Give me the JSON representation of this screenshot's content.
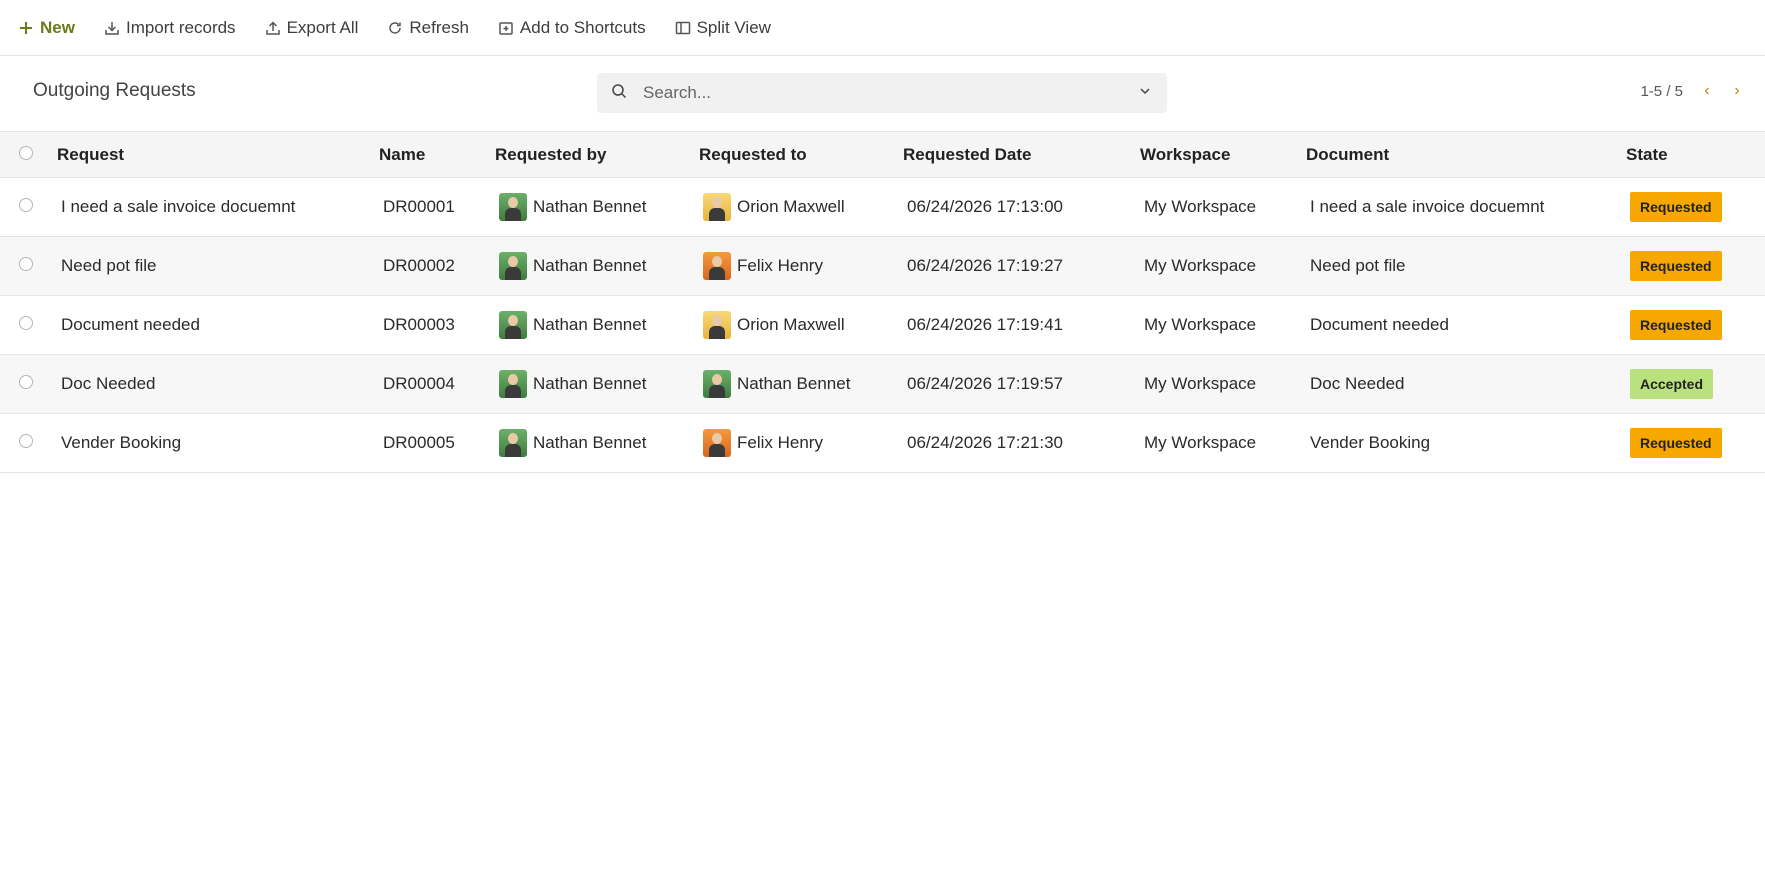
{
  "toolbar": {
    "new_label": "New",
    "import_label": "Import records",
    "export_label": "Export All",
    "refresh_label": "Refresh",
    "shortcuts_label": "Add to Shortcuts",
    "split_label": "Split View"
  },
  "header": {
    "title": "Outgoing Requests",
    "search_placeholder": "Search...",
    "pager_text": "1-5 / 5"
  },
  "table": {
    "columns": [
      "Request",
      "Name",
      "Requested by",
      "Requested to",
      "Requested Date",
      "Workspace",
      "Document",
      "State"
    ],
    "rows": [
      {
        "request": "I need a sale invoice docuemnt",
        "name": "DR00001",
        "by": "Nathan Bennet",
        "by_avatar": "green",
        "to": "Orion Maxwell",
        "to_avatar": "yellow",
        "date": "06/24/2026 17:13:00",
        "workspace": "My Workspace",
        "document": "I need a sale invoice docuemnt",
        "state": "Requested",
        "state_color": "#f7a800"
      },
      {
        "request": "Need pot file",
        "name": "DR00002",
        "by": "Nathan Bennet",
        "by_avatar": "green",
        "to": "Felix Henry",
        "to_avatar": "orange",
        "date": "06/24/2026 17:19:27",
        "workspace": "My Workspace",
        "document": "Need pot file",
        "state": "Requested",
        "state_color": "#f7a800"
      },
      {
        "request": "Document needed",
        "name": "DR00003",
        "by": "Nathan Bennet",
        "by_avatar": "green",
        "to": "Orion Maxwell",
        "to_avatar": "yellow",
        "date": "06/24/2026 17:19:41",
        "workspace": "My Workspace",
        "document": "Document needed",
        "state": "Requested",
        "state_color": "#f7a800"
      },
      {
        "request": "Doc Needed",
        "name": "DR00004",
        "by": "Nathan Bennet",
        "by_avatar": "green",
        "to": "Nathan Bennet",
        "to_avatar": "green",
        "date": "06/24/2026 17:19:57",
        "workspace": "My Workspace",
        "document": "Doc Needed",
        "state": "Accepted",
        "state_color": "#b9e27f"
      },
      {
        "request": "Vender Booking",
        "name": "DR00005",
        "by": "Nathan Bennet",
        "by_avatar": "green",
        "to": "Felix Henry",
        "to_avatar": "orange",
        "date": "06/24/2026 17:21:30",
        "workspace": "My Workspace",
        "document": "Vender Booking",
        "state": "Requested",
        "state_color": "#f7a800"
      }
    ]
  },
  "colors": {
    "accent": "#6b7a1a",
    "pager_arrow": "#c2800c",
    "requested": "#f7a800",
    "accepted": "#b9e27f"
  },
  "icons": {
    "new": "plus-icon",
    "import": "download-icon",
    "export": "upload-icon",
    "refresh": "refresh-icon",
    "shortcuts": "add-box-icon",
    "split": "split-view-icon",
    "search": "search-icon",
    "search_dropdown": "chevron-down-icon",
    "prev": "chevron-left-icon",
    "next": "chevron-right-icon"
  }
}
